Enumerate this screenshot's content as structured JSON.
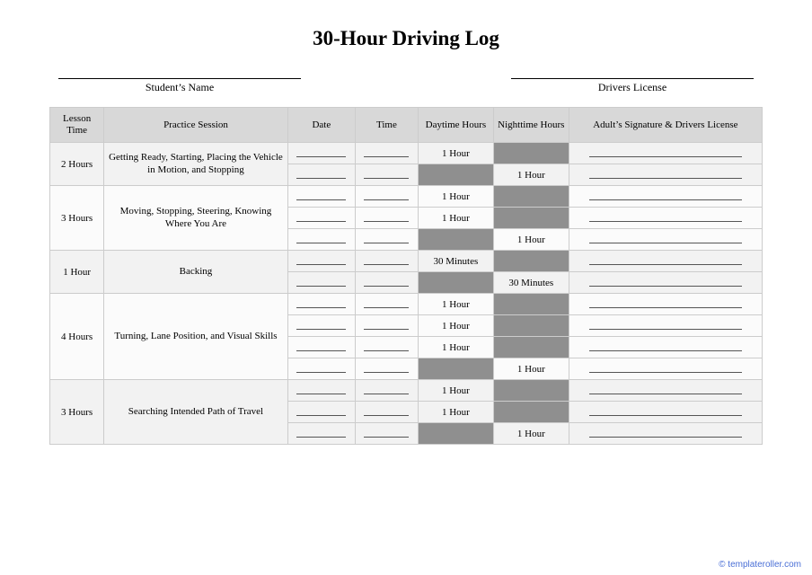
{
  "title": "30-Hour Driving Log",
  "meta": {
    "student_label": "Student’s Name",
    "license_label": "Drivers License"
  },
  "columns": {
    "lesson_time": "Lesson Time",
    "session": "Practice Session",
    "date": "Date",
    "time": "Time",
    "daytime": "Daytime Hours",
    "nighttime": "Nighttime Hours",
    "signature": "Adult’s Signature & Drivers License"
  },
  "lessons": [
    {
      "lesson_time": "2 Hours",
      "session": "Getting Ready, Starting, Placing the Vehicle in Motion, and Stopping",
      "rows": [
        {
          "daytime": "1 Hour",
          "nighttime": ""
        },
        {
          "daytime": "",
          "nighttime": "1 Hour"
        }
      ]
    },
    {
      "lesson_time": "3 Hours",
      "session": "Moving, Stopping, Steering, Knowing Where You Are",
      "rows": [
        {
          "daytime": "1 Hour",
          "nighttime": ""
        },
        {
          "daytime": "1 Hour",
          "nighttime": ""
        },
        {
          "daytime": "",
          "nighttime": "1 Hour"
        }
      ]
    },
    {
      "lesson_time": "1 Hour",
      "session": "Backing",
      "rows": [
        {
          "daytime": "30 Minutes",
          "nighttime": ""
        },
        {
          "daytime": "",
          "nighttime": "30 Minutes"
        }
      ]
    },
    {
      "lesson_time": "4 Hours",
      "session": "Turning, Lane Position, and Visual Skills",
      "rows": [
        {
          "daytime": "1 Hour",
          "nighttime": ""
        },
        {
          "daytime": "1 Hour",
          "nighttime": ""
        },
        {
          "daytime": "1 Hour",
          "nighttime": ""
        },
        {
          "daytime": "",
          "nighttime": "1 Hour"
        }
      ]
    },
    {
      "lesson_time": "3 Hours",
      "session": "Searching Intended Path of Travel",
      "rows": [
        {
          "daytime": "1 Hour",
          "nighttime": ""
        },
        {
          "daytime": "1 Hour",
          "nighttime": ""
        },
        {
          "daytime": "",
          "nighttime": "1 Hour"
        }
      ]
    }
  ],
  "col_widths": {
    "lesson_time": "56",
    "session": "190",
    "date": "70",
    "time": "65",
    "daytime": "78",
    "nighttime": "78",
    "signature": "200"
  },
  "footer": "© templateroller.com"
}
